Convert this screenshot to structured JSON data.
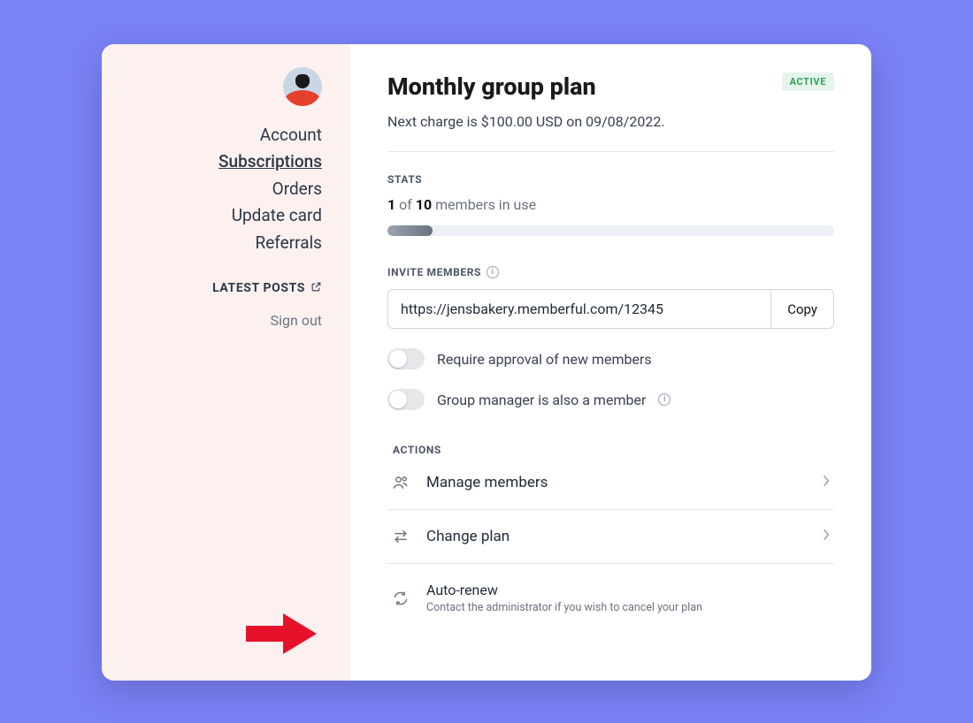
{
  "sidebar": {
    "nav": [
      "Account",
      "Subscriptions",
      "Orders",
      "Update card",
      "Referrals"
    ],
    "active_index": 1,
    "latest_posts": "LATEST POSTS",
    "sign_out": "Sign out"
  },
  "header": {
    "title": "Monthly group plan",
    "badge": "ACTIVE",
    "subtitle": "Next charge is $100.00 USD on 09/08/2022."
  },
  "stats": {
    "label": "STATS",
    "used": "1",
    "of": " of ",
    "total": "10",
    "suffix": " members in use",
    "progress_pct": 10
  },
  "invite": {
    "label": "INVITE MEMBERS",
    "url": "https://jensbakery.memberful.com/12345",
    "copy_label": "Copy"
  },
  "toggles": {
    "require_approval": {
      "label": "Require approval of new members",
      "on": false
    },
    "manager_is_member": {
      "label": "Group manager is also a member",
      "on": false
    }
  },
  "actions": {
    "label": "ACTIONS",
    "manage": "Manage members",
    "change": "Change plan",
    "auto_renew": "Auto-renew",
    "auto_renew_sub": "Contact the administrator if you wish to cancel your plan"
  }
}
